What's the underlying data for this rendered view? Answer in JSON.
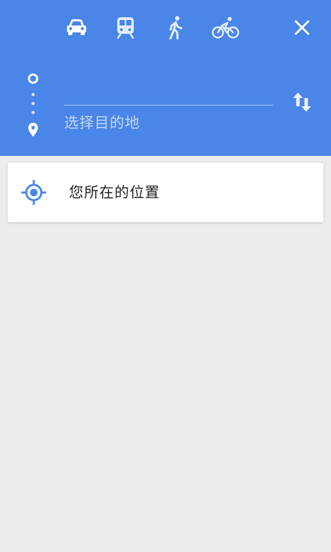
{
  "colors": {
    "header_bg": "#4a86e8",
    "body_bg": "#ececec",
    "card_bg": "#ffffff",
    "accent": "#4a86e8",
    "icon_white": "#ffffff"
  },
  "travel_modes": [
    {
      "icon": "car-icon",
      "selected": true
    },
    {
      "icon": "transit-icon",
      "selected": false
    },
    {
      "icon": "walk-icon",
      "selected": false
    },
    {
      "icon": "bike-icon",
      "selected": false
    }
  ],
  "close_icon": "close-icon",
  "route": {
    "origin_value": "",
    "destination_placeholder": "选择目的地",
    "swap_icon": "swap-icon"
  },
  "suggestions": [
    {
      "icon": "my-location-icon",
      "label": "您所在的位置"
    }
  ]
}
